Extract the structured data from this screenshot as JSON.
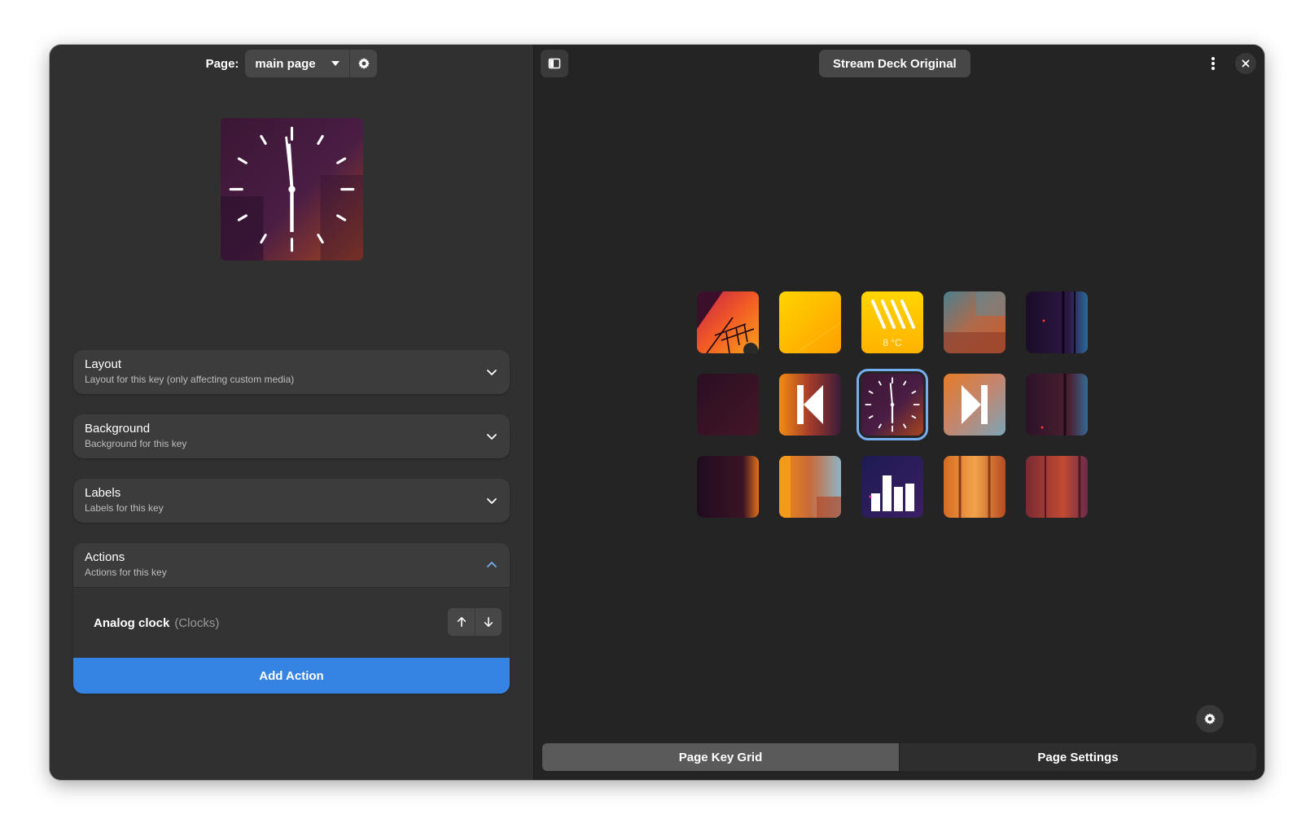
{
  "page_bar": {
    "label": "Page:",
    "selected_page": "main page",
    "gear_icon": "gear-icon"
  },
  "preview": {
    "icon": "analog-clock"
  },
  "sections": [
    {
      "title": "Layout",
      "subtitle": "Layout for this key (only affecting custom media)",
      "expanded": false
    },
    {
      "title": "Background",
      "subtitle": "Background for this key",
      "expanded": false
    },
    {
      "title": "Labels",
      "subtitle": "Labels for this key",
      "expanded": false
    }
  ],
  "actions": {
    "title": "Actions",
    "subtitle": "Actions for this key",
    "expanded": true,
    "items": [
      {
        "name": "Analog clock",
        "category": "(Clocks)"
      }
    ],
    "add_label": "Add Action"
  },
  "header": {
    "device_name": "Stream Deck Original"
  },
  "keys": [
    {
      "id": "key-1-1",
      "icon": "antenna-sunset-image"
    },
    {
      "id": "key-1-2",
      "icon": "yellow-gradient"
    },
    {
      "id": "key-1-3",
      "icon": "weather-rain-icon",
      "label": "8 °C"
    },
    {
      "id": "key-1-4",
      "icon": "sky-image"
    },
    {
      "id": "key-1-5",
      "icon": "dark-building-image"
    },
    {
      "id": "key-2-1",
      "icon": "dark-purple-image"
    },
    {
      "id": "key-2-2",
      "icon": "skip-previous-icon"
    },
    {
      "id": "key-2-3",
      "icon": "analog-clock",
      "selected": true
    },
    {
      "id": "key-2-4",
      "icon": "skip-next-icon"
    },
    {
      "id": "key-2-5",
      "icon": "dark-building-image"
    },
    {
      "id": "key-3-1",
      "icon": "dark-edge-image"
    },
    {
      "id": "key-3-2",
      "icon": "orange-sky-image"
    },
    {
      "id": "key-3-3",
      "icon": "equalizer-icon"
    },
    {
      "id": "key-3-4",
      "icon": "orange-building-image"
    },
    {
      "id": "key-3-5",
      "icon": "red-building-image"
    }
  ],
  "bottom_tabs": [
    {
      "label": "Page Key Grid",
      "active": true
    },
    {
      "label": "Page Settings",
      "active": false
    }
  ],
  "colors": {
    "accent": "#3584e4",
    "selection": "#78aeed"
  }
}
